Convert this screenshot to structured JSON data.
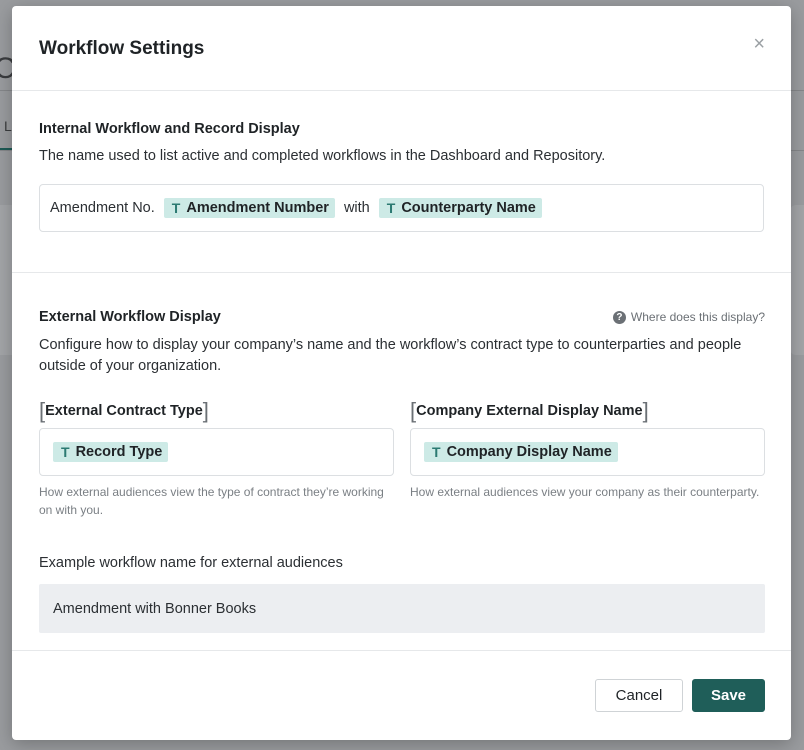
{
  "modal": {
    "title": "Workflow Settings",
    "close_label": "×"
  },
  "internal": {
    "heading": "Internal Workflow and Record Display",
    "description": "The name used to list active and completed workflows in the Dashboard and Repository.",
    "name_parts": {
      "prefix": "Amendment No.",
      "token1": "Amendment Number",
      "joiner": "with",
      "token2": "Counterparty Name"
    }
  },
  "external": {
    "heading": "External Workflow Display",
    "help_link": "Where does this display?",
    "description": "Configure how to display your company’s name and the workflow’s contract type to counterparties and people outside of your organization.",
    "contract_type": {
      "label": "External Contract Type",
      "token": "Record Type",
      "help": "How external audiences view the type of contract they’re working on with you."
    },
    "company_name": {
      "label": "Company External Display Name",
      "token": "Company Display Name",
      "help": "How external audiences view your company as their counterparty."
    },
    "example": {
      "label": "Example workflow name for external audiences",
      "value": "Amendment with Bonner Books"
    }
  },
  "footer": {
    "cancel_label": "Cancel",
    "save_label": "Save"
  },
  "icons": {
    "token_icon": "text-field-icon",
    "help_icon": "question-circle-icon",
    "close_icon": "close-icon"
  },
  "colors": {
    "accent": "#1f5e59",
    "token_bg": "#cdeae6",
    "token_icon": "#2c7a72"
  }
}
